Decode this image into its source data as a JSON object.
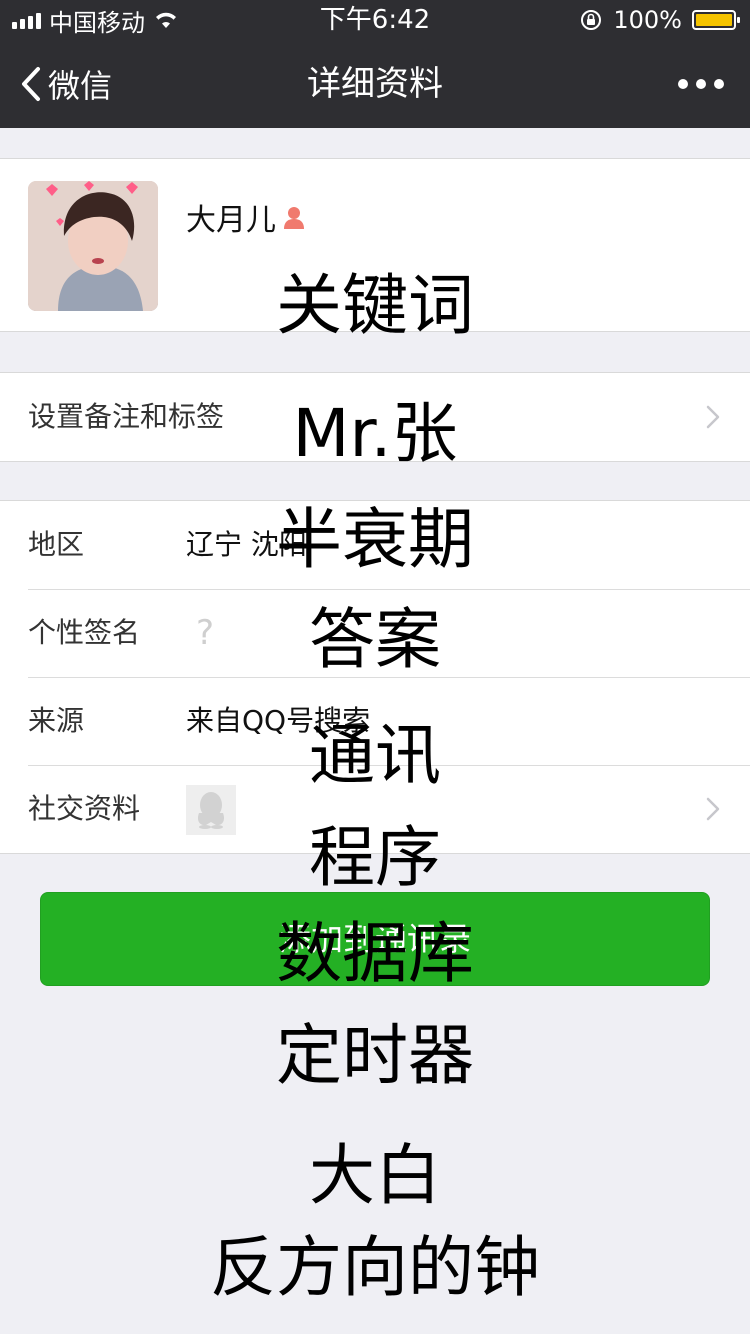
{
  "status_bar": {
    "carrier": "中国移动",
    "time": "下午6:42",
    "battery_text": "100%",
    "battery_level": 1.0,
    "battery_color": "#f5c400"
  },
  "nav": {
    "back_label": "微信",
    "title": "详细资料",
    "more_icon": "more-icon"
  },
  "profile": {
    "name": "大月儿",
    "gender_icon": "female-icon"
  },
  "remark_row": {
    "label": "设置备注和标签"
  },
  "info_rows": {
    "region": {
      "label": "地区",
      "value": "辽宁 沈阳"
    },
    "signature": {
      "label": "个性签名",
      "value": "?"
    },
    "source": {
      "label": "来源",
      "value": "来自QQ号搜索"
    },
    "social": {
      "label": "社交资料",
      "icon": "qq-icon"
    }
  },
  "action": {
    "add_label": "添加到通讯录"
  },
  "overlay_words": [
    "关键词",
    "Mr.张",
    "半衰期",
    "答案",
    "通讯",
    "程序",
    "数据库",
    "定时器",
    "大白",
    "反方向的钟"
  ],
  "colors": {
    "nav_bg": "#2e2e32",
    "button_green": "#1aad19",
    "page_bg": "#efeff4"
  }
}
